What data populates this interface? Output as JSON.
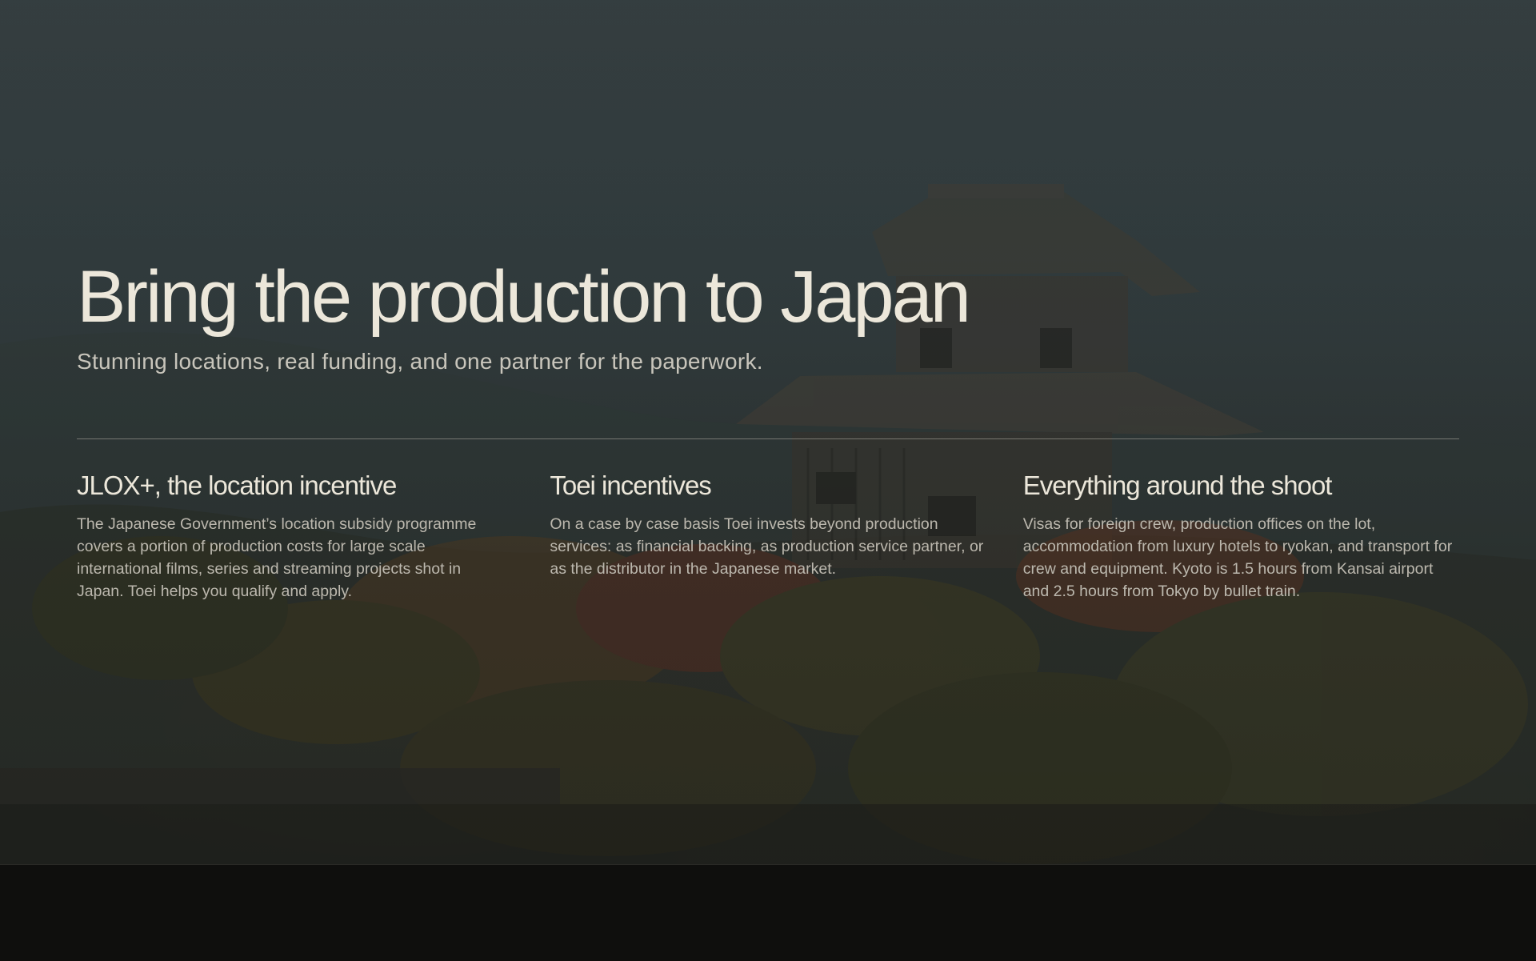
{
  "hero": {
    "title": "Bring the production to Japan",
    "subtitle": "Stunning locations, real funding, and one partner for the paperwork."
  },
  "features": [
    {
      "title": "JLOX+, the location incentive",
      "text": "The Japanese Government’s location subsidy programme covers a portion of production costs for large scale international films, series and streaming projects shot in Japan. Toei helps you qualify and apply."
    },
    {
      "title": "Toei incentives",
      "text": "On a case by case basis Toei invests beyond production services: as financial backing, as production service partner, or as the distributor in the Japanese market."
    },
    {
      "title": "Everything around the shoot",
      "text": "Visas for foreign crew, production offices on the lot, accommodation from luxury hotels to ryokan, and transport for crew and equipment. Kyoto is 1.5 hours from Kansai airport and 2.5 hours from Tokyo by bullet train."
    }
  ],
  "colors": {
    "text_primary": "#ece7da",
    "text_secondary": "#bcb8ae",
    "footer_bg": "#0f0f0d"
  }
}
